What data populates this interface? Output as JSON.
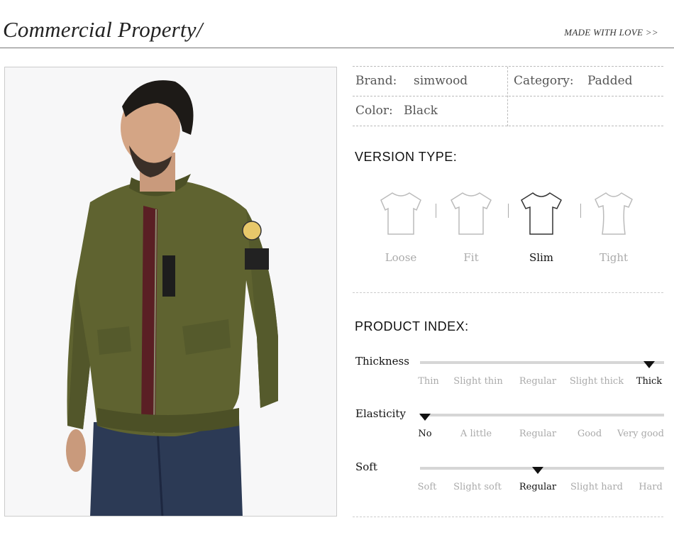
{
  "header": {
    "title": "Commercial Property/",
    "tagline": "MADE WITH LOVE >>"
  },
  "info": {
    "brand_label": "Brand:",
    "brand_value": "simwood",
    "category_label": "Category:",
    "category_value": "Padded",
    "color_label": "Color:",
    "color_value": "Black"
  },
  "version": {
    "title": "VERSION TYPE:",
    "options": [
      "Loose",
      "Fit",
      "Slim",
      "Tight"
    ],
    "selected": "Slim"
  },
  "index": {
    "title": "PRODUCT INDEX:",
    "rows": [
      {
        "label": "Thickness",
        "options": [
          "Thin",
          "Slight thin",
          "Regular",
          "Slight thick",
          "Thick"
        ],
        "selected": "Thick"
      },
      {
        "label": "Elasticity",
        "options": [
          "No",
          "A little",
          "Regular",
          "Good",
          "Very good"
        ],
        "selected": "No"
      },
      {
        "label": "Soft",
        "options": [
          "Soft",
          "Slight soft",
          "Regular",
          "Slight hard",
          "Hard"
        ],
        "selected": "Regular"
      }
    ]
  },
  "colors": {
    "accent": "#111111",
    "muted": "#aaaaaa",
    "jacket": "#5f6330"
  }
}
